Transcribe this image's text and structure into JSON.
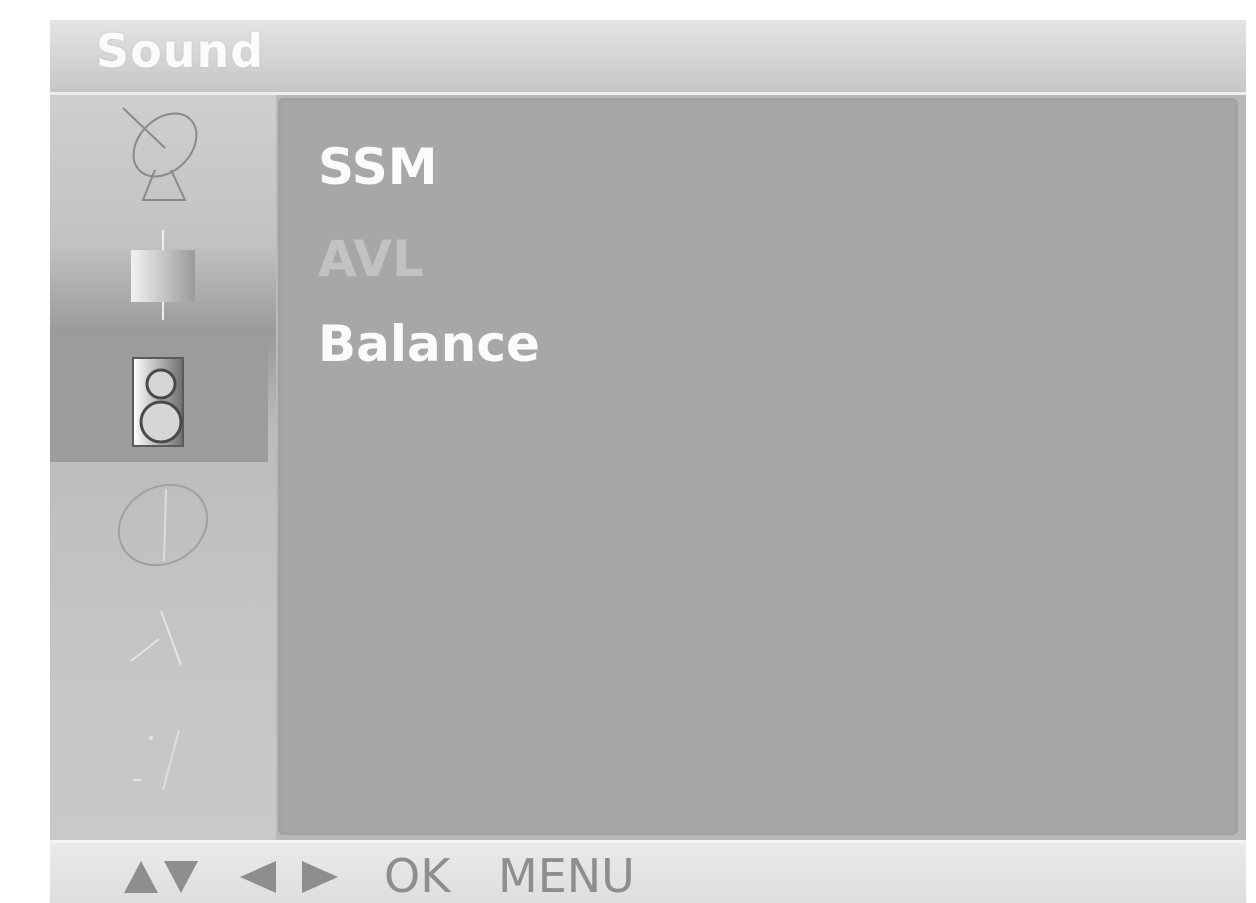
{
  "header": {
    "title": "Sound"
  },
  "sidebar": {
    "items": [
      {
        "icon": "satellite-dish-icon",
        "selected": false
      },
      {
        "icon": "picture-icon",
        "selected": false
      },
      {
        "icon": "speaker-icon",
        "selected": true
      },
      {
        "icon": "clock-icon",
        "selected": false
      },
      {
        "icon": "settings-icon",
        "selected": false
      },
      {
        "icon": "screen-icon",
        "selected": false
      }
    ]
  },
  "menu": {
    "items": [
      {
        "label": "SSM",
        "state": "active"
      },
      {
        "label": "AVL",
        "state": "dim"
      },
      {
        "label": "Balance",
        "state": "active"
      }
    ]
  },
  "footer": {
    "ok_label": "OK",
    "menu_label": "MENU"
  }
}
